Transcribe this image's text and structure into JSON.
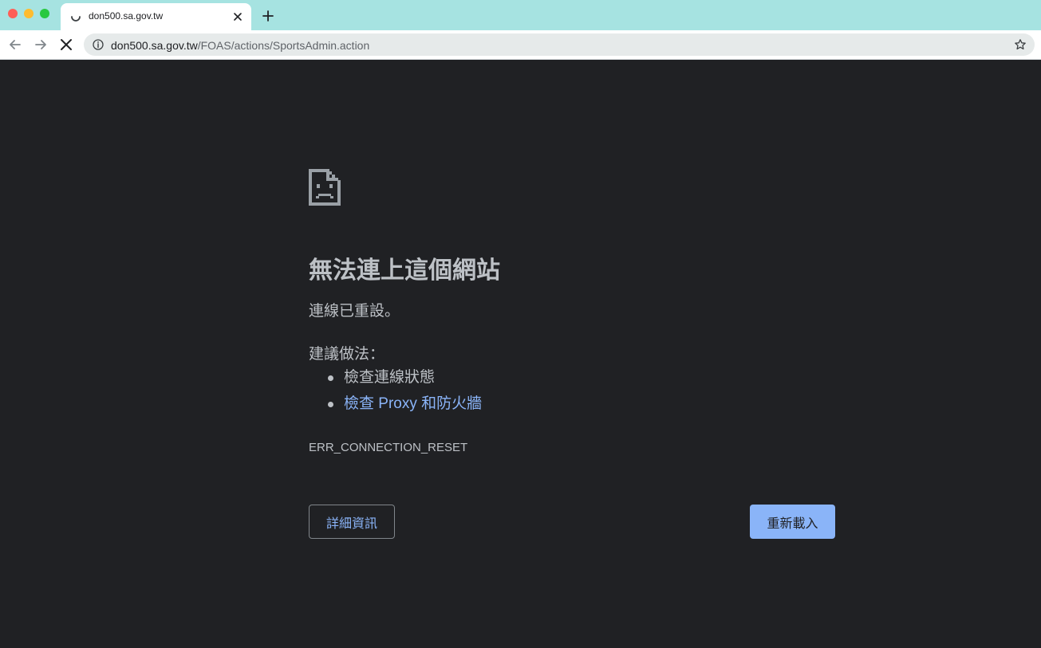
{
  "browser": {
    "tab": {
      "title": "don500.sa.gov.tw"
    },
    "address": {
      "host": "don500.sa.gov.tw",
      "path": "/FOAS/actions/SportsAdmin.action"
    },
    "colors": {
      "tabstrip": "#a6e3e1",
      "page_background": "#202124",
      "link": "#8ab4f8",
      "text": "#bdc1c6"
    }
  },
  "error_page": {
    "icon": "sad-document-icon",
    "heading": "無法連上這個網站",
    "subtitle": "連線已重設。",
    "suggestions_label": "建議做法：",
    "suggestions": [
      {
        "text": "檢查連線狀態"
      },
      {
        "text": "檢查 Proxy 和防火牆"
      }
    ],
    "error_code": "ERR_CONNECTION_RESET",
    "details_button": "詳細資訊",
    "reload_button": "重新載入"
  }
}
